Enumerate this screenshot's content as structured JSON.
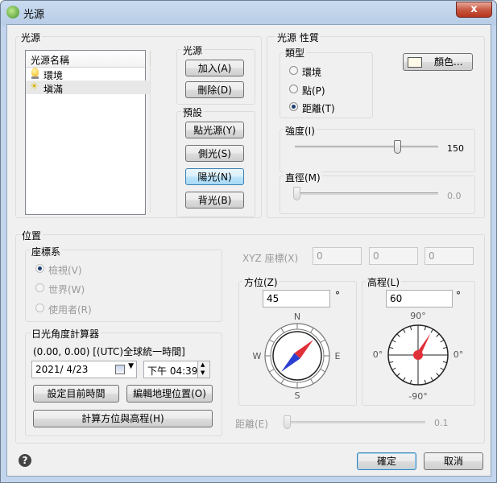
{
  "window": {
    "title": "光源",
    "close_symbol": "x"
  },
  "light_source_group": {
    "label": "光源",
    "list_header": "光源名稱",
    "items": [
      {
        "label": "環境",
        "icon": "bulb-icon"
      },
      {
        "label": "塡滿",
        "icon": "sun-icon"
      }
    ]
  },
  "source_buttons": {
    "label": "光源",
    "add": "加入(A)",
    "delete": "刪除(D)"
  },
  "preset_buttons": {
    "label": "預設",
    "point": "點光源(Y)",
    "side": "側光(S)",
    "sun": "陽光(N)",
    "back": "背光(B)"
  },
  "properties": {
    "label": "光源 性質",
    "type_label": "類型",
    "types": [
      "環境",
      "點(P)",
      "距離(T)"
    ],
    "selected_type": "距離(T)",
    "color_button": "顏色...",
    "color_swatch": "#fffbe8",
    "intensity_label": "強度(I)",
    "intensity_value": "150",
    "intensity_fraction": 0.7,
    "diameter_label": "直徑(M)",
    "diameter_value": "0.0",
    "diameter_fraction": 0.0
  },
  "position": {
    "label": "位置",
    "coord_label": "座標系",
    "coords": [
      "檢視(V)",
      "世界(W)",
      "使用者(R)"
    ],
    "selected_coord": "檢視(V)",
    "xyz_label": "XYZ 座標(X)",
    "xyz_values": [
      "0",
      "0",
      "0"
    ],
    "sun_calc_label": "日光角度計算器",
    "location_text": "(0.00, 0.00) [(UTC)全球統一時間]",
    "date": "2021/  4/23",
    "time": "下午 04:39::",
    "set_now_button": "設定目前時間",
    "edit_location_button": "編輯地理位置(O)",
    "calc_button": "計算方位與高程(H)",
    "azimuth_label": "方位(Z)",
    "azimuth_value": "45",
    "azimuth_degrees": 45,
    "elevation_label": "高程(L)",
    "elevation_value": "60",
    "elevation_degrees": 60,
    "degree_symbol": "°",
    "compass": {
      "n": "N",
      "s": "S",
      "e": "E",
      "w": "W"
    },
    "elev_marks": {
      "top": "90°",
      "bottom": "-90°",
      "left": "0°",
      "right": "0°"
    },
    "distance_label": "距離(E)",
    "distance_value": "0.1",
    "distance_fraction": 0.0
  },
  "footer": {
    "help_symbol": "?",
    "ok": "確定",
    "cancel": "取消"
  }
}
